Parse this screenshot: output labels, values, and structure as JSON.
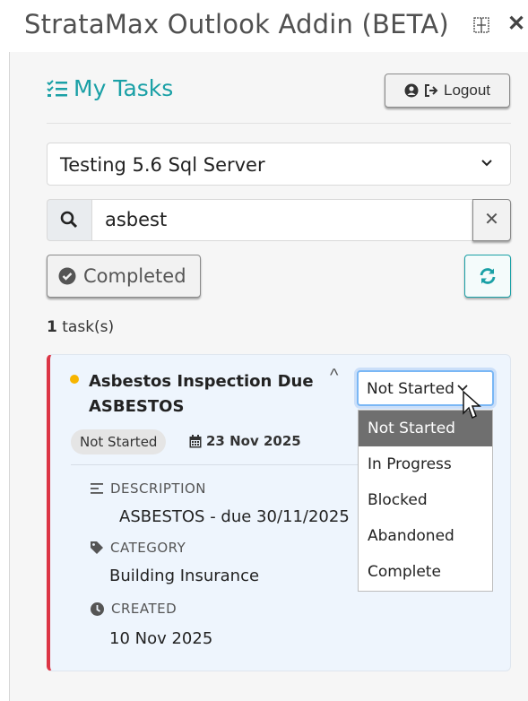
{
  "window": {
    "title": "StrataMax Outlook Addin (BETA)"
  },
  "header": {
    "title": "My Tasks",
    "logout_label": "Logout"
  },
  "server_select": {
    "value": "Testing 5.6 Sql Server"
  },
  "search": {
    "value": "asbest"
  },
  "filter": {
    "completed_label": "Completed"
  },
  "task_count": {
    "number": "1",
    "suffix": "task(s)"
  },
  "task": {
    "title_line1": "Asbestos Inspection Due",
    "title_line2": "ASBESTOS",
    "status": "Not Started",
    "due_date": "23 Nov 2025",
    "status_select_value": "Not Started",
    "description_label": "DESCRIPTION",
    "description_value": "ASBESTOS - due 30/11/2025",
    "category_label": "CATEGORY",
    "category_value": "Building Insurance",
    "created_label": "CREATED",
    "created_value": "10 Nov 2025",
    "priority_color": "#f7b500",
    "accent_color": "#dc3545"
  },
  "status_options": [
    "Not Started",
    "In Progress",
    "Blocked",
    "Abandoned",
    "Complete"
  ],
  "colors": {
    "brand": "#1aa0a6"
  }
}
